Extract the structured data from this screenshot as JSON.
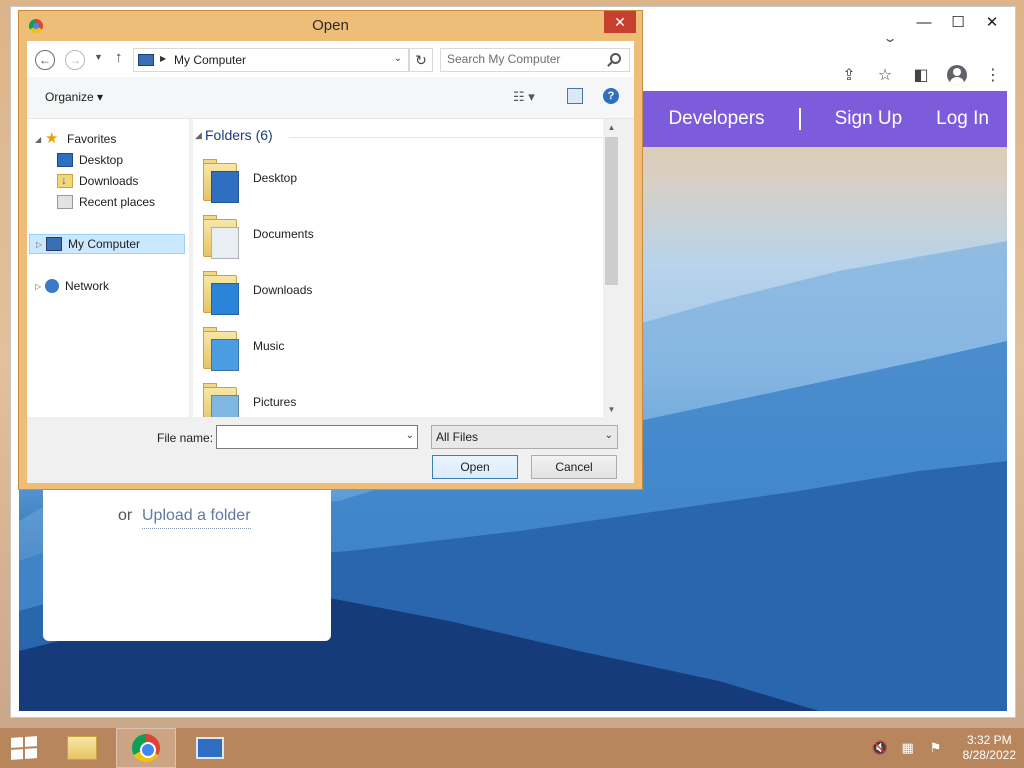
{
  "browser": {
    "controls": {
      "minimize": "—",
      "maximize": "☐",
      "close": "✕"
    },
    "tab_search": "⌄"
  },
  "webpage": {
    "nav": {
      "developers": "Developers",
      "sign_up": "Sign Up",
      "log_in": "Log In"
    },
    "upload": {
      "or": "or",
      "folder_link": "Upload a folder"
    },
    "nav_color": "#7c5cdb"
  },
  "dialog": {
    "title": "Open",
    "close": "✕",
    "address": "My Computer",
    "search_placeholder": "Search My Computer",
    "organize": "Organize ▾",
    "help": "?",
    "nav_tree": {
      "favorites": "Favorites",
      "favorites_items": [
        "Desktop",
        "Downloads",
        "Recent places"
      ],
      "my_computer": "My Computer",
      "network": "Network"
    },
    "group_header": "Folders (6)",
    "folders": [
      {
        "name": "Desktop",
        "icon": "desktop-folder-icon"
      },
      {
        "name": "Documents",
        "icon": "documents-folder-icon"
      },
      {
        "name": "Downloads",
        "icon": "downloads-folder-icon"
      },
      {
        "name": "Music",
        "icon": "music-folder-icon"
      },
      {
        "name": "Pictures",
        "icon": "pictures-folder-icon"
      }
    ],
    "file_name_label": "File name:",
    "file_name_value": "",
    "file_type": "All Files",
    "open_button": "Open",
    "cancel_button": "Cancel"
  },
  "taskbar": {
    "time": "3:32 PM",
    "date": "8/28/2022"
  }
}
